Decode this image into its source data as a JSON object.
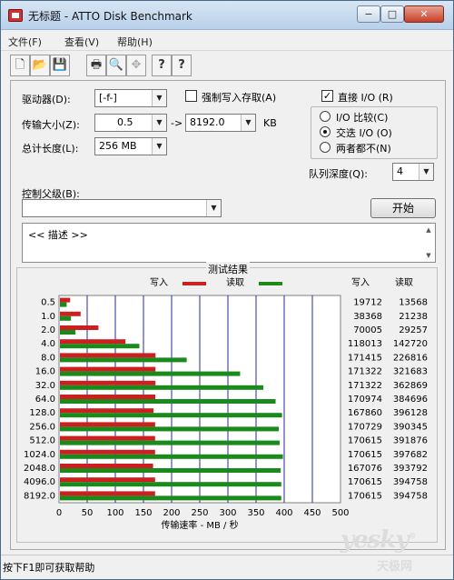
{
  "window": {
    "title": "无标题 - ATTO Disk Benchmark",
    "min_glyph": "−",
    "max_glyph": "□",
    "close_glyph": "✕"
  },
  "menu": {
    "file": "文件(F)",
    "view": "查看(V)",
    "help": "帮助(H)"
  },
  "toolbar": {
    "new": "🗋",
    "open": "📂",
    "save": "💾",
    "print": "🖶",
    "preview": "🔍",
    "move": "✥",
    "help": "?",
    "context_help": "?"
  },
  "form": {
    "drive_label": "驱动器(D):",
    "drive_value": "[-f-]",
    "transfer_label": "传输大小(Z):",
    "transfer_from": "0.5",
    "to_symbol": "-> ",
    "transfer_to": "8192.0",
    "kb_unit": "KB",
    "total_label": "总计长度(L):",
    "total_value": "256 MB",
    "force_write_label": "强制写入存取(A)",
    "force_write_checked": false,
    "direct_io_label": "直接 I/O (R)",
    "direct_io_checked": true,
    "io_compare_label": "I/O 比较(C)",
    "overlapped_io_label": "交迭 I/O (O)",
    "neither_label": "两者都不(N)",
    "selected_io": "overlapped",
    "queue_label": "队列深度(Q):",
    "queue_value": "4",
    "controller_label": "控制父级(B):",
    "controller_value": "",
    "start_button": "开始",
    "description": "<< 描述 >>"
  },
  "results": {
    "title": "测试结果",
    "write_header": "写入",
    "read_header": "读取"
  },
  "status": {
    "text": "按下F1即可获取帮助"
  },
  "watermark": {
    "brand": "yesky",
    "brand_dot": "®",
    "sub": "天极网"
  },
  "chart_data": {
    "type": "bar",
    "orientation": "horizontal",
    "title": "测试结果",
    "xlabel": "传输速率 - MB / 秒",
    "xlim": [
      0,
      500
    ],
    "xticks": [
      0,
      50,
      100,
      150,
      200,
      250,
      300,
      350,
      400,
      450,
      500
    ],
    "grid": true,
    "legend_placement": "top",
    "categories": [
      "0.5",
      "1.0",
      "2.0",
      "4.0",
      "8.0",
      "16.0",
      "32.0",
      "64.0",
      "128.0",
      "256.0",
      "512.0",
      "1024.0",
      "2048.0",
      "4096.0",
      "8192.0"
    ],
    "series": [
      {
        "name": "写入",
        "color": "#cc2020",
        "values": [
          19.712,
          38.368,
          70.005,
          118.013,
          171.415,
          171.322,
          171.322,
          170.974,
          167.86,
          170.729,
          170.615,
          170.615,
          167.076,
          170.615,
          170.615
        ]
      },
      {
        "name": "读取",
        "color": "#1a8a1a",
        "values": [
          13.568,
          21.238,
          29.257,
          142.72,
          226.816,
          321.683,
          362.869,
          384.696,
          396.128,
          390.345,
          391.876,
          397.682,
          393.792,
          394.758,
          394.758
        ]
      }
    ],
    "write_kb": [
      "19712",
      "38368",
      "70005",
      "118013",
      "171415",
      "171322",
      "171322",
      "170974",
      "167860",
      "170729",
      "170615",
      "170615",
      "167076",
      "170615",
      "170615"
    ],
    "read_kb": [
      "13568",
      "21238",
      "29257",
      "142720",
      "226816",
      "321683",
      "362869",
      "384696",
      "396128",
      "390345",
      "391876",
      "397682",
      "393792",
      "394758",
      "394758"
    ]
  }
}
